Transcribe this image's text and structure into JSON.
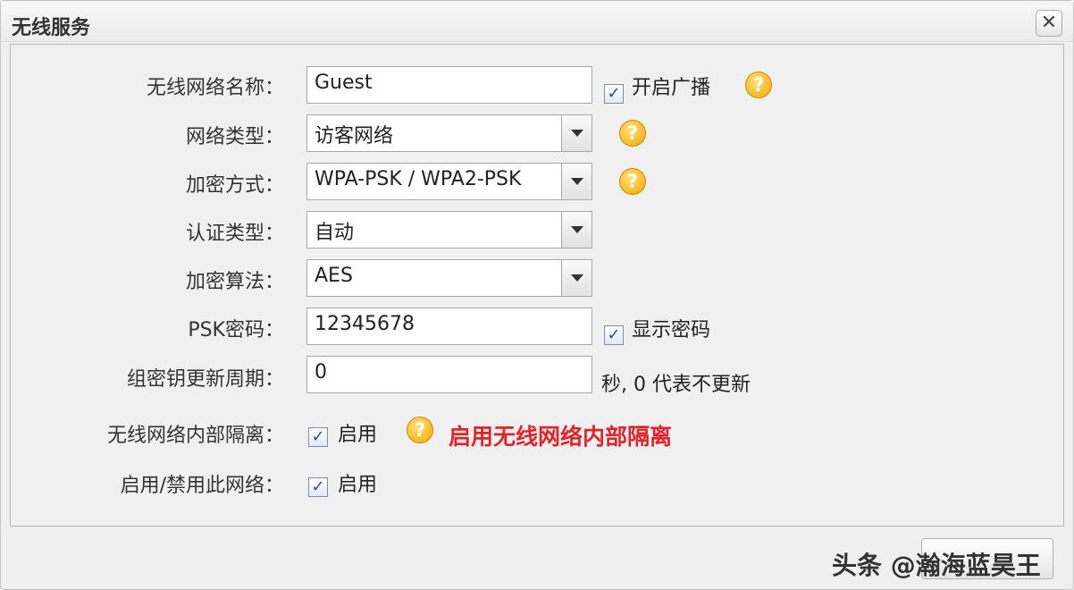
{
  "dialog": {
    "title": "无线服务",
    "close_glyph": "✕"
  },
  "form": {
    "ssid": {
      "label": "无线网络名称：",
      "value": "Guest",
      "broadcast_label": "开启广播",
      "broadcast_checked": true
    },
    "network_type": {
      "label": "网络类型：",
      "value": "访客网络"
    },
    "encryption": {
      "label": "加密方式：",
      "value": "WPA-PSK / WPA2-PSK"
    },
    "auth_type": {
      "label": "认证类型：",
      "value": "自动"
    },
    "algorithm": {
      "label": "加密算法：",
      "value": "AES"
    },
    "psk": {
      "label": "PSK密码：",
      "value": "12345678",
      "show_label": "显示密码",
      "show_checked": true
    },
    "group_key": {
      "label": "组密钥更新周期：",
      "value": "0",
      "unit_note": "秒, 0 代表不更新"
    },
    "isolation": {
      "label": "无线网络内部隔离：",
      "enable_label": "启用",
      "checked": true,
      "annotation": "启用无线网络内部隔离"
    },
    "network_enable": {
      "label": "启用/禁用此网络：",
      "enable_label": "启用",
      "checked": true
    }
  },
  "icons": {
    "help": "?",
    "check": "✓"
  },
  "watermark": "头条 @瀚海蓝昊王"
}
